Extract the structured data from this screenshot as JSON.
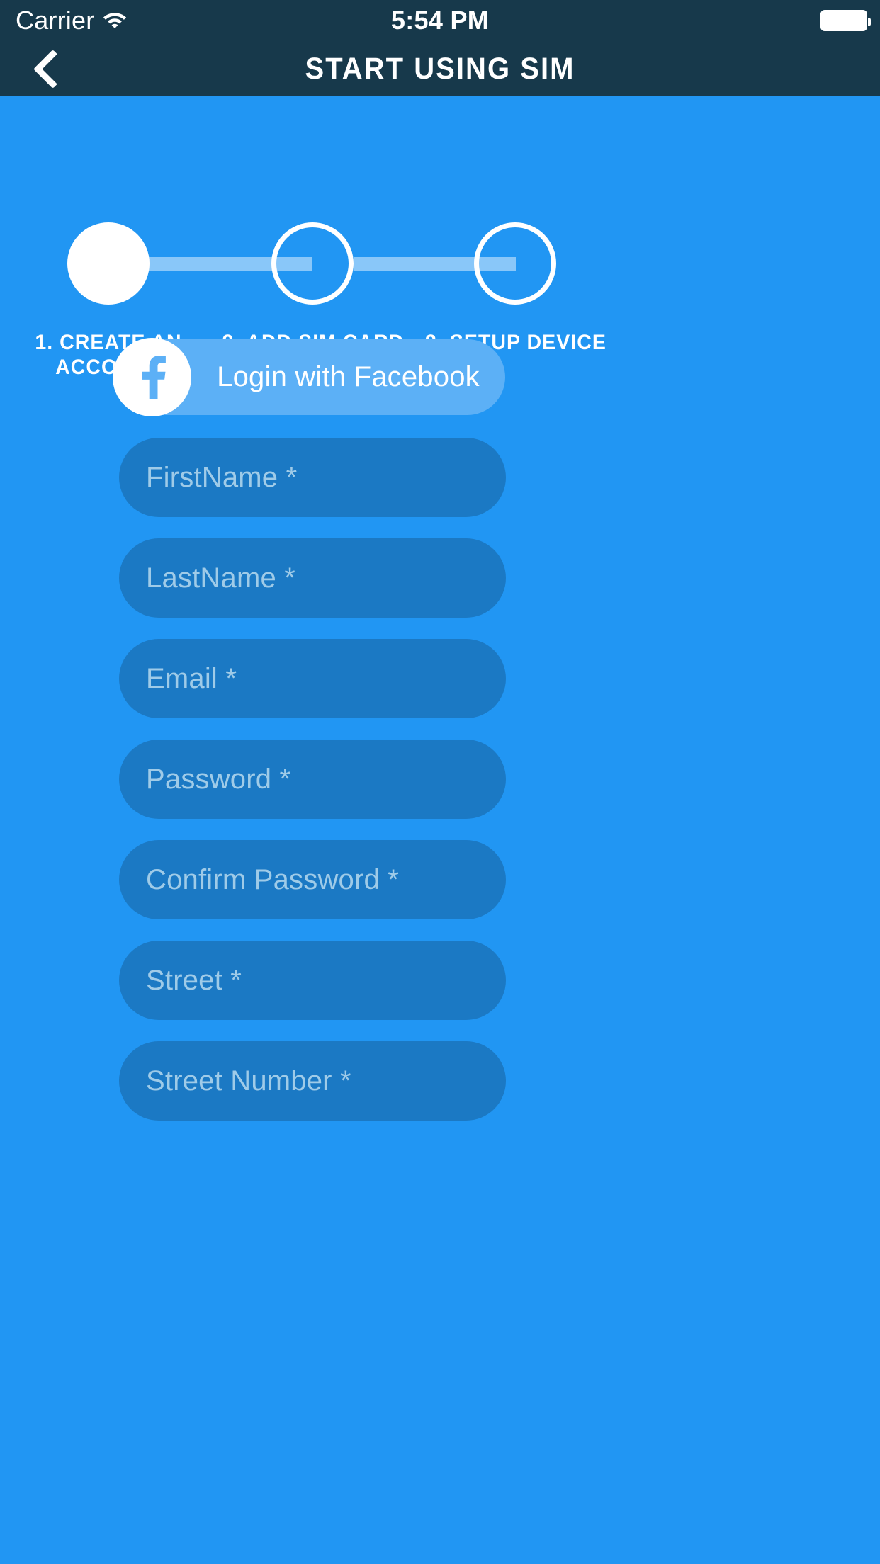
{
  "status_bar": {
    "carrier": "Carrier",
    "wifi_icon": "wifi-icon",
    "time": "5:54 PM",
    "battery_icon": "battery-full-icon"
  },
  "nav_bar": {
    "back_icon": "chevron-left-icon",
    "title": "START USING SIM"
  },
  "stepper": {
    "steps": [
      {
        "label": "1. CREATE AN ACCOUNT",
        "state": "active"
      },
      {
        "label": "2. ADD SIM CARD",
        "state": "inactive"
      },
      {
        "label": "3. SETUP DEVICE",
        "state": "inactive"
      }
    ]
  },
  "facebook_button": {
    "label": "Login with Facebook",
    "icon": "facebook-f-icon",
    "icon_glyph": "f"
  },
  "form": {
    "fields": [
      {
        "name": "first-name",
        "placeholder": "FirstName *",
        "value": ""
      },
      {
        "name": "last-name",
        "placeholder": "LastName *",
        "value": ""
      },
      {
        "name": "email",
        "placeholder": "Email *",
        "value": ""
      },
      {
        "name": "password",
        "placeholder": "Password *",
        "value": ""
      },
      {
        "name": "confirm-password",
        "placeholder": "Confirm Password *",
        "value": ""
      },
      {
        "name": "street",
        "placeholder": "Street *",
        "value": ""
      },
      {
        "name": "street-number",
        "placeholder": "Street Number *",
        "value": ""
      }
    ]
  },
  "colors": {
    "header_bg": "#17394b",
    "page_bg": "#2196f3",
    "field_bg": "#1b79c4",
    "field_placeholder": "#9fcbe8",
    "facebook_bg": "#5cb0f6",
    "accent_white": "#ffffff",
    "track": "rgba(255,255,255,0.47)"
  }
}
